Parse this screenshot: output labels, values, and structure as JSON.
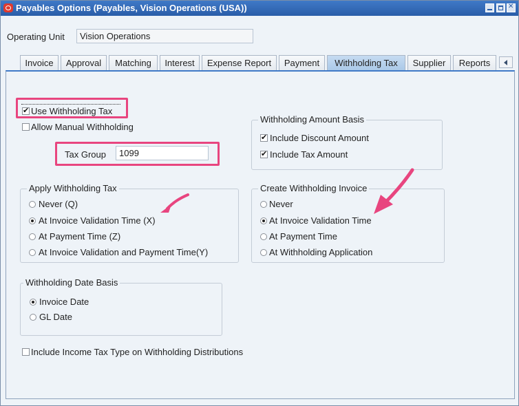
{
  "window": {
    "title": "Payables Options (Payables, Vision Operations (USA))"
  },
  "operating_unit": {
    "label": "Operating Unit",
    "value": "Vision Operations"
  },
  "tabs": [
    {
      "label": "Invoice",
      "active": false
    },
    {
      "label": "Approval",
      "active": false
    },
    {
      "label": "Matching",
      "active": false
    },
    {
      "label": "Interest",
      "active": false
    },
    {
      "label": "Expense Report",
      "active": false
    },
    {
      "label": "Payment",
      "active": false
    },
    {
      "label": "Withholding Tax",
      "active": true
    },
    {
      "label": "Supplier",
      "active": false
    },
    {
      "label": "Reports",
      "active": false
    }
  ],
  "use_withholding_tax": {
    "label": "Use Withholding Tax",
    "checked": true
  },
  "allow_manual_withholding": {
    "label": "Allow Manual Withholding",
    "checked": false
  },
  "tax_group": {
    "label": "Tax Group",
    "value": "1099"
  },
  "withholding_amount_basis": {
    "title": "Withholding Amount Basis",
    "include_discount": {
      "label": "Include Discount Amount",
      "checked": true
    },
    "include_tax": {
      "label": "Include Tax Amount",
      "checked": true
    }
  },
  "apply_withholding_tax": {
    "title": "Apply Withholding Tax",
    "options": [
      {
        "label": "Never (Q)",
        "checked": false
      },
      {
        "label": "At Invoice Validation Time (X)",
        "checked": true
      },
      {
        "label": "At Payment Time (Z)",
        "checked": false
      },
      {
        "label": "At Invoice Validation and Payment Time(Y)",
        "checked": false
      }
    ]
  },
  "create_withholding_invoice": {
    "title": "Create Withholding Invoice",
    "options": [
      {
        "label": "Never",
        "checked": false
      },
      {
        "label": "At Invoice Validation Time",
        "checked": true
      },
      {
        "label": "At Payment Time",
        "checked": false
      },
      {
        "label": "At Withholding Application",
        "checked": false
      }
    ]
  },
  "withholding_date_basis": {
    "title": "Withholding Date Basis",
    "options": [
      {
        "label": "Invoice Date",
        "checked": true
      },
      {
        "label": "GL Date",
        "checked": false
      }
    ]
  },
  "include_income_tax_type": {
    "label": "Include Income Tax Type on Withholding Distributions",
    "checked": false
  },
  "colors": {
    "titlebar": "#2a5da8",
    "highlight": "#e8457f",
    "panel_bg": "#eef3f8"
  }
}
